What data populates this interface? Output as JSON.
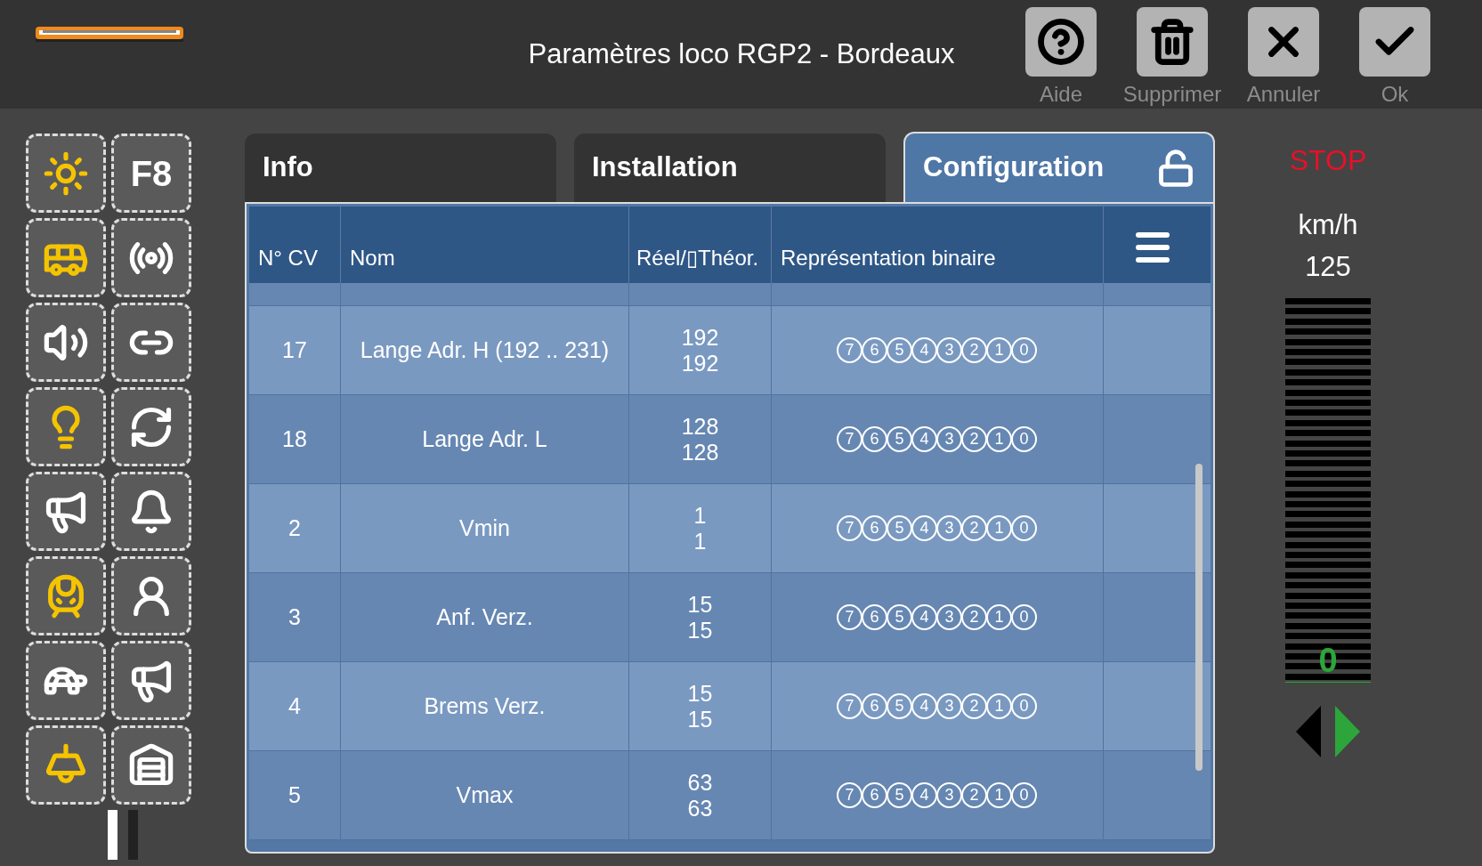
{
  "header": {
    "title": "Paramètres loco RGP2 - Bordeaux",
    "buttons": [
      {
        "kind": "help",
        "label": "Aide"
      },
      {
        "kind": "delete",
        "label": "Supprimer"
      },
      {
        "kind": "cancel",
        "label": "Annuler"
      },
      {
        "kind": "ok",
        "label": "Ok"
      }
    ]
  },
  "functions": [
    {
      "kind": "headlight",
      "on": true
    },
    {
      "kind": "f8",
      "on": false,
      "label": "F8"
    },
    {
      "kind": "cab-sound",
      "on": true
    },
    {
      "kind": "speaker",
      "on": false
    },
    {
      "kind": "door",
      "on": false
    },
    {
      "kind": "coupler",
      "on": false
    },
    {
      "kind": "lights",
      "on": true
    },
    {
      "kind": "shuffle",
      "on": false
    },
    {
      "kind": "horn",
      "on": false
    },
    {
      "kind": "whistle",
      "on": false
    },
    {
      "kind": "cab-light",
      "on": true
    },
    {
      "kind": "conductor",
      "on": false
    },
    {
      "kind": "slow",
      "on": false
    },
    {
      "kind": "announce",
      "on": false
    },
    {
      "kind": "ceiling-light",
      "on": true
    },
    {
      "kind": "station",
      "on": false
    }
  ],
  "tabs": [
    {
      "label": "Info",
      "selected": false
    },
    {
      "label": "Installation",
      "selected": false
    },
    {
      "label": "Configuration",
      "selected": true,
      "unlocked": true
    }
  ],
  "table": {
    "columns": [
      "N° CV",
      "Nom",
      "Réel/▯Théor.",
      "Représentation binaire"
    ],
    "rows": [
      {
        "cv": "17",
        "name": "Lange Adr. H (192 .. 231)",
        "real": "192",
        "theor": "192",
        "bits": [
          "7",
          "6",
          "5",
          "4",
          "3",
          "2",
          "1",
          "0"
        ]
      },
      {
        "cv": "18",
        "name": "Lange Adr. L",
        "real": "128",
        "theor": "128",
        "bits": [
          "7",
          "6",
          "5",
          "4",
          "3",
          "2",
          "1",
          "0"
        ]
      },
      {
        "cv": "2",
        "name": "Vmin",
        "real": "1",
        "theor": "1",
        "bits": [
          "7",
          "6",
          "5",
          "4",
          "3",
          "2",
          "1",
          "0"
        ]
      },
      {
        "cv": "3",
        "name": "Anf. Verz.",
        "real": "15",
        "theor": "15",
        "bits": [
          "7",
          "6",
          "5",
          "4",
          "3",
          "2",
          "1",
          "0"
        ]
      },
      {
        "cv": "4",
        "name": "Brems Verz.",
        "real": "15",
        "theor": "15",
        "bits": [
          "7",
          "6",
          "5",
          "4",
          "3",
          "2",
          "1",
          "0"
        ]
      },
      {
        "cv": "5",
        "name": "Vmax",
        "real": "63",
        "theor": "63",
        "bits": [
          "7",
          "6",
          "5",
          "4",
          "3",
          "2",
          "1",
          "0"
        ]
      }
    ]
  },
  "throttle": {
    "status": "STOP",
    "unit": "km/h",
    "max": "125",
    "level": 0,
    "speed": "0",
    "directions": [
      {
        "kind": "reverse",
        "selected": false
      },
      {
        "kind": "forward",
        "selected": true
      }
    ]
  }
}
